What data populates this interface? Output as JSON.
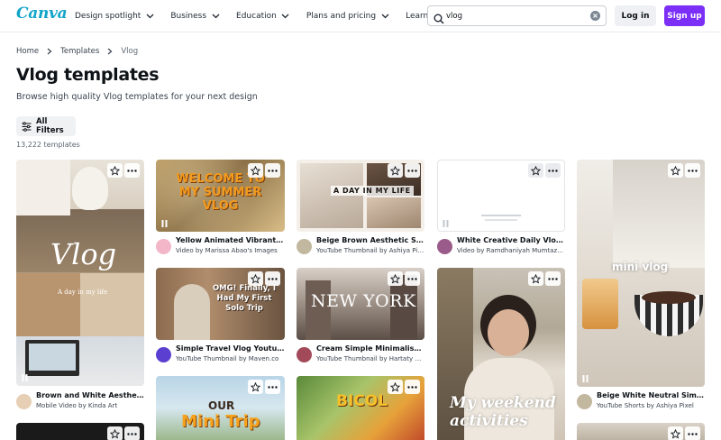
{
  "header": {
    "logo": "Canva",
    "nav": [
      {
        "label": "Design spotlight"
      },
      {
        "label": "Business"
      },
      {
        "label": "Education"
      },
      {
        "label": "Plans and pricing"
      },
      {
        "label": "Learn"
      }
    ],
    "search_value": "vlog",
    "login_label": "Log in",
    "signup_label": "Sign up"
  },
  "breadcrumb": {
    "home": "Home",
    "templates": "Templates",
    "current": "Vlog"
  },
  "page": {
    "title": "Vlog templates",
    "subtitle": "Browse high quality Vlog templates for your next design",
    "filters_label": "All Filters",
    "count": "13,222 templates"
  },
  "cards": [
    {
      "title": "Brown and White Aesthetic D...",
      "subtitle": "Mobile Video by Kinda Art",
      "overlay": "Vlog",
      "overlay2": "A day in my life"
    },
    {
      "title": "Yellow Animated Vibrant Sum...",
      "subtitle": "Video by Marissa Abao's Images",
      "overlay": "WELCOME TO MY SUMMER VLOG"
    },
    {
      "title": "Beige Brown Aesthetic Simple...",
      "subtitle": "YouTube Thumbnail by Ashiya Pixel",
      "overlay": "A DAY IN MY LIFE"
    },
    {
      "title": "White Creative Daily Vlog Intr...",
      "subtitle": "Video by Ramdhaniyah Mumtazah's"
    },
    {
      "title": "Beige White Neutral Simple M...",
      "subtitle": "YouTube Shorts by Ashiya Pixel",
      "overlay": "mini vlog"
    },
    {
      "title": "Simple Travel Vlog Youtube T...",
      "subtitle": "YouTube Thumbnail by Maven.co",
      "overlay": "OMG! Finally, I Had My First Solo Trip"
    },
    {
      "title": "Cream Simple Minimalist Wee...",
      "subtitle": "YouTube Thumbnail by Hartaty Wija...",
      "overlay": "NEW YORK"
    },
    {
      "overlay": "My weekend activities"
    },
    {
      "overlay": "OUR",
      "overlay2": "Mini Trip"
    },
    {
      "overlay": "BICOL"
    }
  ],
  "colors": {
    "accent": "#7b2ff7",
    "logo": "#11a5c8"
  }
}
